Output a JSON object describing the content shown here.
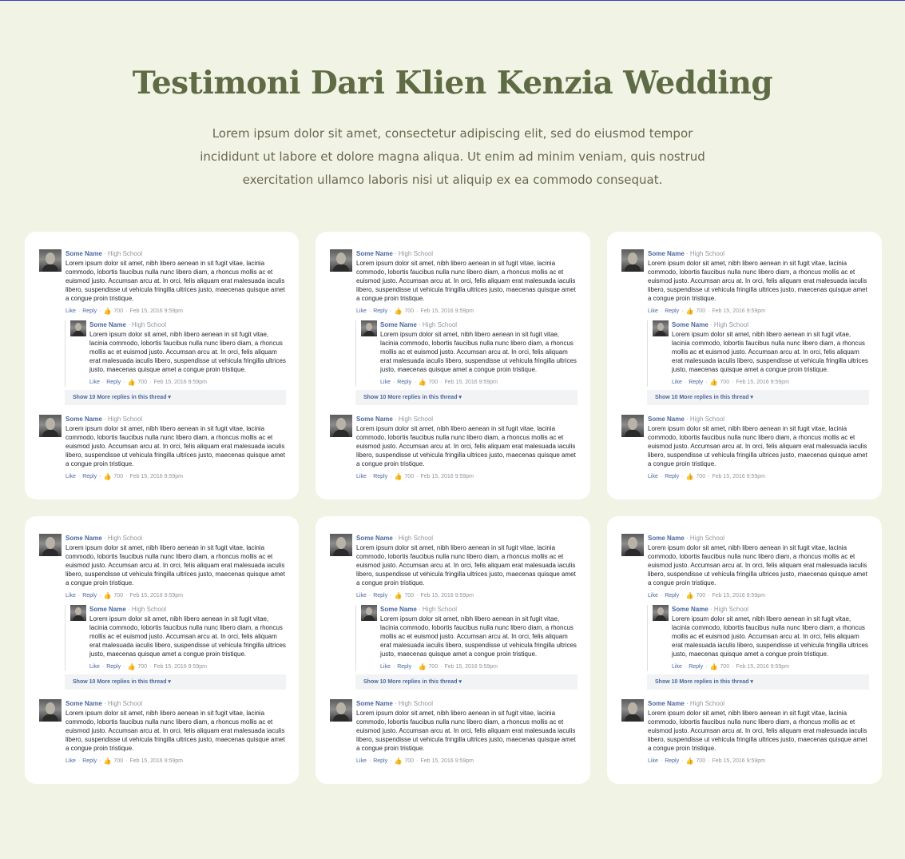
{
  "header": {
    "title": "Testimoni Dari Klien Kenzia Wedding",
    "subtitle": "Lorem ipsum dolor sit amet, consectetur adipiscing elit, sed do eiusmod tempor incididunt ut labore et dolore magna aliqua. Ut enim ad minim veniam, quis nostrud exercitation ullamco laboris nisi ut aliquip ex ea commodo consequat."
  },
  "comment": {
    "name": "Some Name",
    "school": "· High School",
    "text": "Lorem ipsum dolor sit amet, nibh libero aenean in sit fugit vitae, lacinia commodo, lobortis faucibus nulla nunc libero diam, a rhoncus mollis ac et euismod justo. Accumsan arcu at. In orci, felis aliquam erat malesuada iaculis libero, suspendisse ut vehicula fringilla ultrices justo, maecenas quisque amet a congue proin tristique.",
    "like": "Like",
    "reply": "Reply",
    "likes_count": "700",
    "date": "Feb 15, 2016 9:59pm",
    "more_replies": "Show 10 More replies in this thread ▾",
    "avatar_icon": "user-avatar-icon",
    "thumb_icon": "thumbs-up-icon"
  },
  "cards": [
    1,
    2,
    3,
    4,
    5,
    6
  ],
  "colors": {
    "background": "#f1f4e4",
    "title": "#5f6b45",
    "link": "#4b67a1"
  }
}
